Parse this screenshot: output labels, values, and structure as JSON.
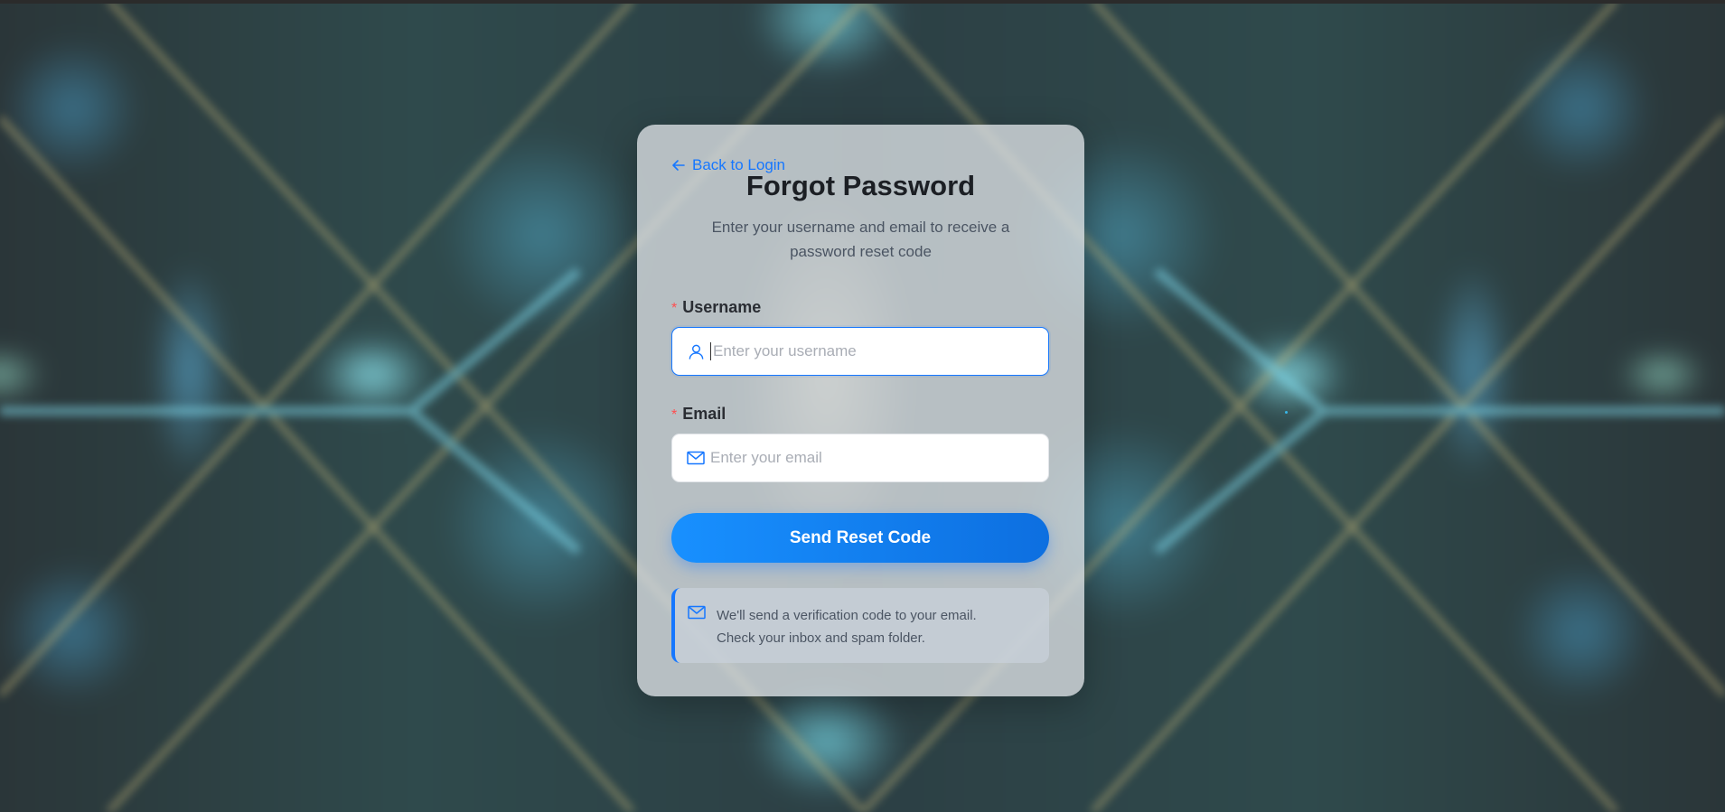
{
  "card": {
    "back_link": "Back to Login",
    "title": "Forgot Password",
    "subtitle": "Enter your username and email to receive a password reset code"
  },
  "form": {
    "username": {
      "required_mark": "*",
      "label": "Username",
      "placeholder": "Enter your username",
      "value": "",
      "icon": "user-icon"
    },
    "email": {
      "required_mark": "*",
      "label": "Email",
      "placeholder": "Enter your email",
      "value": "",
      "icon": "mail-icon"
    },
    "submit_label": "Send Reset Code"
  },
  "info": {
    "icon": "mail-icon",
    "text": "We'll send a verification code to your email. Check your inbox and spam folder."
  },
  "colors": {
    "accent": "#1677ff",
    "required": "#ff4d4f"
  }
}
